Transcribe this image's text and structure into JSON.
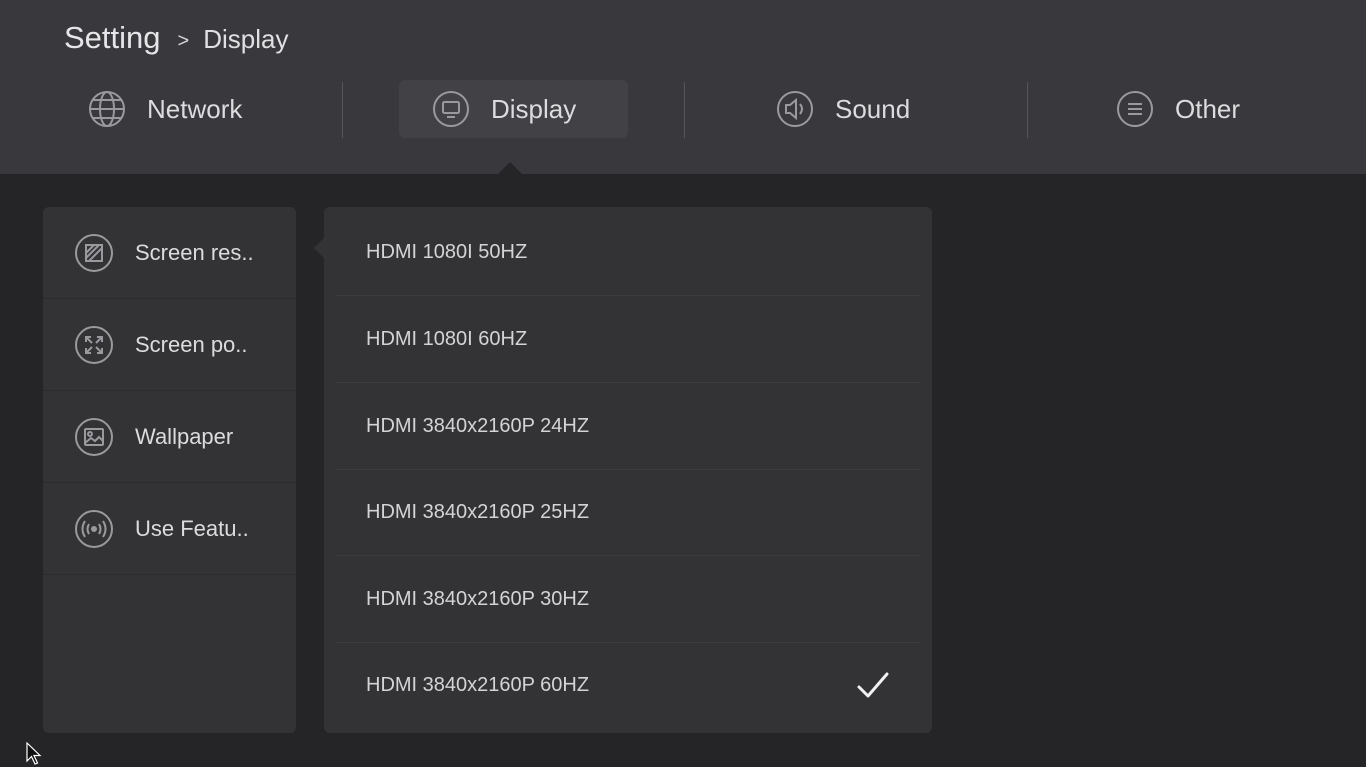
{
  "breadcrumb": {
    "root": "Setting",
    "separator": ">",
    "current": "Display"
  },
  "tabs": [
    {
      "label": "Network",
      "icon": "globe-icon",
      "active": false
    },
    {
      "label": "Display",
      "icon": "monitor-icon",
      "active": true
    },
    {
      "label": "Sound",
      "icon": "speaker-icon",
      "active": false
    },
    {
      "label": "Other",
      "icon": "menu-icon",
      "active": false
    }
  ],
  "sidebar": {
    "items": [
      {
        "label": "Screen res..",
        "icon": "resolution-icon",
        "selected": true
      },
      {
        "label": "Screen po..",
        "icon": "expand-icon",
        "selected": false
      },
      {
        "label": "Wallpaper",
        "icon": "image-icon",
        "selected": false
      },
      {
        "label": "Use Featu..",
        "icon": "broadcast-icon",
        "selected": false
      }
    ]
  },
  "resolutions": {
    "items": [
      {
        "label": "HDMI 1080I 50HZ",
        "selected": false
      },
      {
        "label": "HDMI 1080I 60HZ",
        "selected": false
      },
      {
        "label": "HDMI 3840x2160P 24HZ",
        "selected": false
      },
      {
        "label": "HDMI 3840x2160P 25HZ",
        "selected": false
      },
      {
        "label": "HDMI 3840x2160P 30HZ",
        "selected": false
      },
      {
        "label": "HDMI 3840x2160P 60HZ",
        "selected": true
      }
    ],
    "check_icon": "checkmark-icon"
  },
  "colors": {
    "header_bg": "#39393d",
    "page_bg": "#252527",
    "panel_bg": "#333336",
    "active_tab_bg": "#414146",
    "text": "#dcdcde"
  }
}
